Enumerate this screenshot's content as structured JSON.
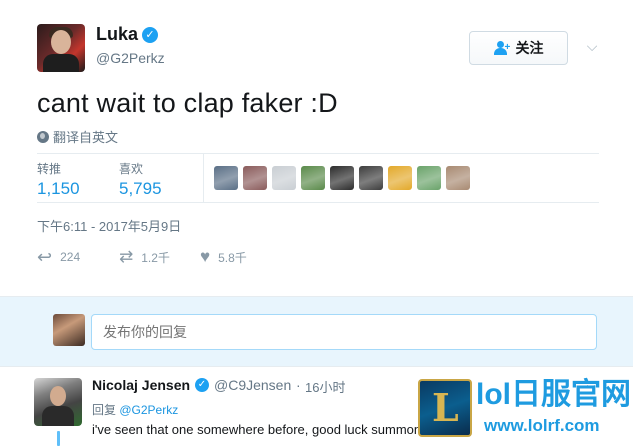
{
  "tweet": {
    "author_name": "Luka",
    "author_handle": "@G2Perkz",
    "follow_label": "关注",
    "text": "cant wait to clap faker :D",
    "translate_label": "翻译自英文",
    "stats": {
      "retweets_label": "转推",
      "retweets_value": "1,150",
      "likes_label": "喜欢",
      "likes_value": "5,795"
    },
    "likers": [
      {
        "color": "#5a6f86"
      },
      {
        "color": "#8a5b5b"
      },
      {
        "color": "#c9ced3"
      },
      {
        "color": "#5a8a4a"
      },
      {
        "color": "#2c2c2c"
      },
      {
        "color": "#3d3d3d"
      },
      {
        "color": "#e3a92a"
      },
      {
        "color": "#6aa36a"
      },
      {
        "color": "#a88a72"
      }
    ],
    "timestamp": "下午6:11 - 2017年5月9日",
    "actions": {
      "reply_count": "224",
      "retweet_count": "1.2千",
      "like_count": "5.8千"
    }
  },
  "reply_box": {
    "placeholder": "发布你的回复"
  },
  "reply": {
    "author_name": "Nicolaj Jensen",
    "author_handle": "@C9Jensen",
    "separator": "·",
    "time": "16小时",
    "reply_prefix": "回复",
    "reply_to": "@G2Perkz",
    "text": "i've seen that one somewhere before, good luck summoner!! :)"
  },
  "watermark": {
    "logo_letter": "L",
    "title": "lol日服官网",
    "url": "www.lolrf.com"
  },
  "colors": {
    "accent": "#1da1f2",
    "link": "#1b95e0",
    "muted": "#657786",
    "reply_bg": "#e8f5fd"
  }
}
